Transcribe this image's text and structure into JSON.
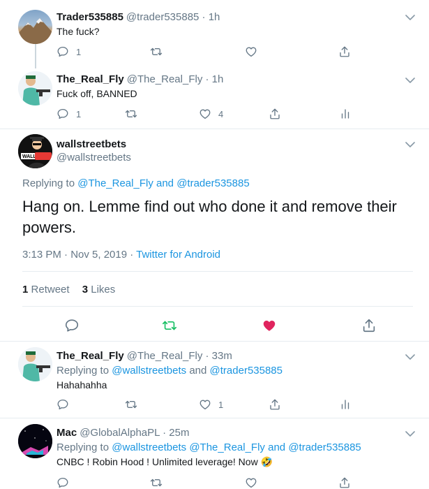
{
  "tweets": [
    {
      "name": "Trader535885",
      "handle": "@trader535885 · 1h",
      "text": "The fuck?",
      "actions": {
        "reply": "1",
        "retweet": "",
        "like": "",
        "share": ""
      }
    },
    {
      "name": "The_Real_Fly",
      "handle": "@The_Real_Fly · 1h",
      "text": "Fuck off, BANNED",
      "actions": {
        "reply": "1",
        "retweet": "",
        "like": "4",
        "share": ""
      }
    }
  ],
  "main": {
    "name": "wallstreetbets",
    "handle": "@wallstreetbets",
    "replying_prefix": "Replying to ",
    "replying_user1": "@The_Real_Fly",
    "replying_and": " and ",
    "replying_user2": "@trader535885",
    "text_line1": "Hang on. Lemme find out who done it and remove their",
    "text_line2": "powers.",
    "timestamp": "3:13 PM · Nov 5, 2019 · ",
    "source": "Twitter for Android",
    "retweet_count": "1",
    "retweet_label": "Retweet",
    "like_count": "3",
    "like_label": "Likes",
    "colors": {
      "retweet": "#17bf63",
      "like": "#e0245e",
      "link": "#1b95e0"
    }
  },
  "replies": [
    {
      "name": "The_Real_Fly",
      "handle": "@The_Real_Fly · 33m",
      "replying_prefix": "Replying to ",
      "replying_user1": "@wallstreetbets",
      "replying_and": " and ",
      "replying_user2": "@trader535885",
      "text": "Hahahahha",
      "actions": {
        "reply": "",
        "retweet": "",
        "like": "1",
        "share": ""
      }
    },
    {
      "name": "Mac",
      "handle": "@GlobalAlphaPL · 25m",
      "replying_prefix": "Replying to ",
      "replying_user1": "@wallstreetbets",
      "replying_mid": " @The_Real_Fly",
      "replying_and": " and ",
      "replying_user2": "@trader535885",
      "text": "CNBC ! Robin Hood ! Unlimited leverage! Now",
      "emoji": "🤣"
    }
  ],
  "icons": [
    "reply-icon",
    "retweet-icon",
    "like-icon",
    "share-icon",
    "analytics-icon",
    "chevron-down-icon"
  ]
}
